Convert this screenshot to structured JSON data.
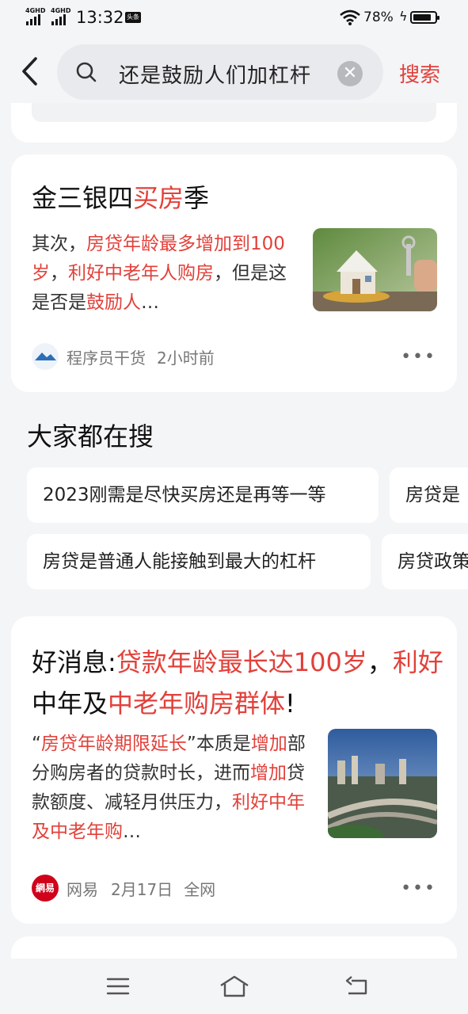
{
  "status": {
    "net1": "4GHD",
    "net2": "4GHD",
    "time": "13:32",
    "badge": "头条",
    "battery": "78%"
  },
  "search": {
    "query": "还是鼓励人们加杠杆",
    "submit_label": "搜索"
  },
  "result1": {
    "title_parts": [
      "金三银四",
      "买房",
      "季"
    ],
    "snippet_parts": [
      "其次，",
      "房贷年龄最多增加到100岁",
      "，",
      "利好中老年人购房",
      "，但是这是否是",
      "鼓励人",
      "…"
    ],
    "source": "程序员干货",
    "time": "2小时前",
    "more": "•••"
  },
  "people_search": {
    "title": "大家都在搜",
    "chips": [
      "2023刚需是尽快买房还是再等一等",
      "房贷是",
      "房贷是普通人能接触到最大的杠杆",
      "房贷政策"
    ]
  },
  "result2": {
    "title_parts": [
      "好消息:",
      "贷款年龄最长达100岁",
      "，",
      "利好",
      "中年及",
      "中老年购房群体",
      "!"
    ],
    "snippet_parts": [
      "“",
      "房贷年龄期限延长",
      "”本质是",
      "增加",
      "部分购房者的贷款时长，进而",
      "增加",
      "贷款额度、减轻月供压力，",
      "利好中年及中老年购",
      "…"
    ],
    "source": "网易",
    "date": "2月17日",
    "scope": "全网",
    "more": "•••",
    "logo_text": "網易"
  },
  "colors": {
    "accent": "#e2403a",
    "background": "#f4f5f7"
  },
  "icons": [
    "back-arrow-icon",
    "search-icon",
    "clear-icon",
    "wifi-icon",
    "battery-icon",
    "menu-icon",
    "home-icon",
    "back-nav-icon"
  ]
}
